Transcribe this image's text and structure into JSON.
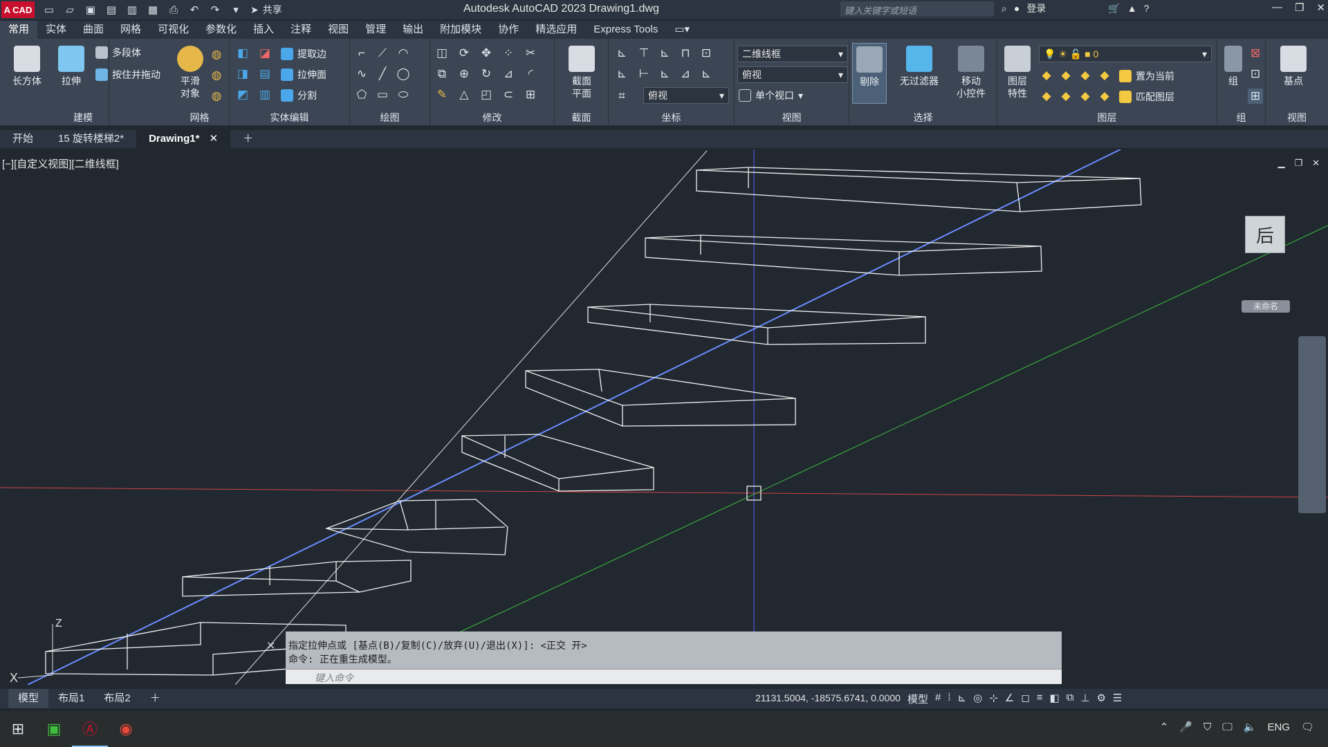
{
  "app": {
    "logo_text": "A CAD",
    "title": "Autodesk AutoCAD 2023    Drawing1.dwg",
    "share_label": "共享",
    "search_placeholder": "键入关键字或短语",
    "login_label": "登录"
  },
  "ribbon_tabs": [
    "常用",
    "实体",
    "曲面",
    "网格",
    "可视化",
    "参数化",
    "插入",
    "注释",
    "视图",
    "管理",
    "输出",
    "附加模块",
    "协作",
    "精选应用",
    "Express Tools"
  ],
  "panels": {
    "modeling": {
      "title": "建模",
      "box": "长方体",
      "extrude": "拉伸",
      "polysolid": "多段体",
      "presspull": "按住并拖动"
    },
    "mesh": {
      "title": "网格",
      "smooth": "平滑\n对象"
    },
    "solid_edit": {
      "title": "实体编辑",
      "extract": "提取边",
      "extrude_face": "拉伸面",
      "separate": "分割"
    },
    "draw": {
      "title": "绘图"
    },
    "modify": {
      "title": "修改"
    },
    "section": {
      "title": "截面",
      "plane": "截面\n平面"
    },
    "coords": {
      "title": "坐标",
      "view_dropdown": "俯视"
    },
    "view": {
      "title": "视图",
      "visual_style": "二维线框",
      "view_dropdown": "俯视",
      "viewport": "单个视口"
    },
    "selection": {
      "title": "选择",
      "cull": "剔除",
      "no_filter": "无过滤器",
      "gizmo": "移动\n小控件"
    },
    "layers": {
      "title": "图层",
      "props": "图层\n特性",
      "layer_value": "0",
      "set_current": "置为当前",
      "match_layer": "匹配图层"
    },
    "groups": {
      "title": "组",
      "group": "组"
    },
    "view2": {
      "title": "视图",
      "base": "基点"
    }
  },
  "file_tabs": [
    "开始",
    "15 旋转楼梯2*",
    "Drawing1*"
  ],
  "viewport": {
    "label": "[−][自定义视图][二维线框]",
    "viewcube_face": "后",
    "wcs_label": "未命名"
  },
  "command": {
    "line1": "指定拉伸点或 [基点(B)/复制(C)/放弃(U)/退出(X)]:  <正交 开>",
    "line2": "命令:   正在重生成模型。",
    "input_placeholder": "键入命令"
  },
  "layout_tabs": [
    "模型",
    "布局1",
    "布局2"
  ],
  "status": {
    "coordinates": "21131.5004, -18575.6741, 0.0000",
    "model_label": "模型"
  },
  "taskbar": {
    "lang": "ENG"
  },
  "colors": {
    "viewport_bg": "#212830",
    "ribbon_bg": "#3b4553",
    "accent_red": "#c8102e",
    "axis_blue": "#5b7cff",
    "axis_green": "#3cbf3c",
    "axis_red": "#d04545"
  }
}
